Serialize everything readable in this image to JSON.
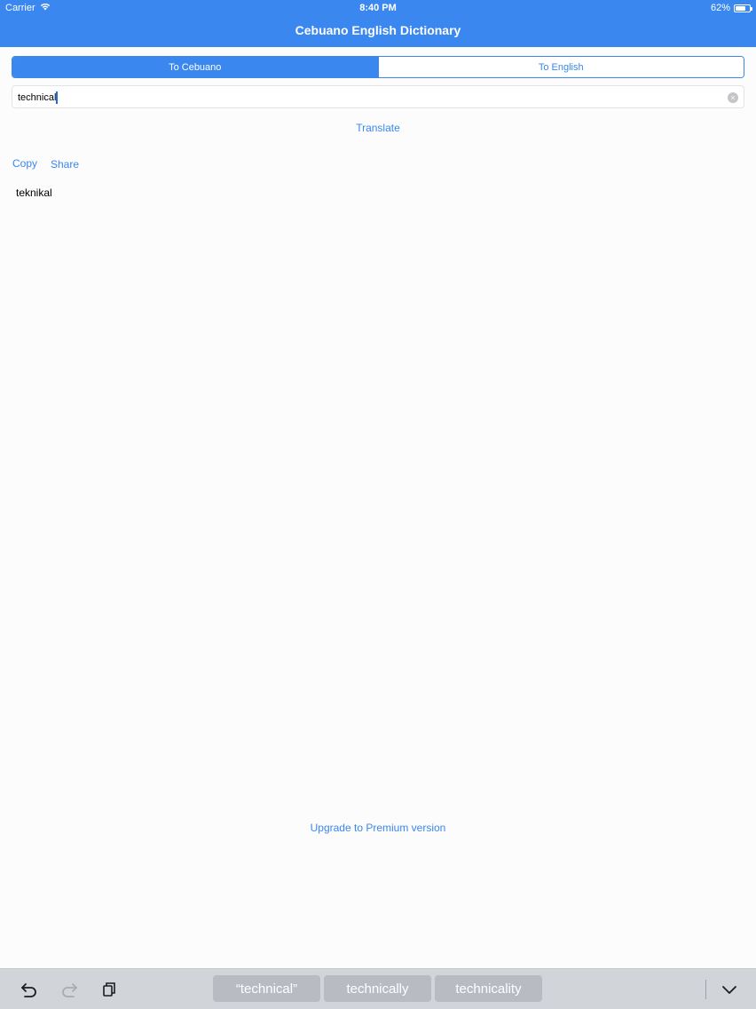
{
  "status_bar": {
    "carrier": "Carrier",
    "time": "8:40 PM",
    "battery_text": "62%",
    "battery_level": 0.62
  },
  "nav": {
    "title": "Cebuano English Dictionary"
  },
  "segments": {
    "items": [
      "To Cebuano",
      "To English"
    ],
    "selected_index": 0
  },
  "search": {
    "value": "technical"
  },
  "actions": {
    "translate_label": "Translate",
    "copy_label": "Copy",
    "share_label": "Share"
  },
  "result": {
    "text": "teknikal"
  },
  "footer": {
    "upgrade_label": "Upgrade to Premium version"
  },
  "keyboard_bar": {
    "suggestions": [
      "“technical”",
      "technically",
      "technicality"
    ],
    "icons": [
      "undo-icon",
      "redo-icon",
      "paste-icon",
      "dismiss-keyboard-icon"
    ]
  },
  "colors": {
    "accent": "#3a87ef",
    "keyboard_bg": "#d1d4d9"
  }
}
